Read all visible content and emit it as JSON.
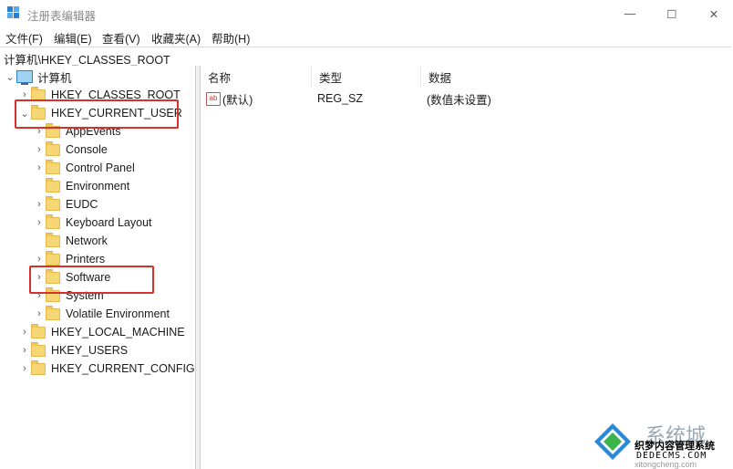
{
  "window": {
    "title": "注册表编辑器",
    "minimize": "—",
    "maximize": "☐",
    "close": "✕"
  },
  "menu": [
    "文件(F)",
    "编辑(E)",
    "查看(V)",
    "收藏夹(A)",
    "帮助(H)"
  ],
  "address": "计算机\\HKEY_CLASSES_ROOT",
  "tree": {
    "root": "计算机",
    "hives": {
      "classes_root": "HKEY_CLASSES_ROOT",
      "current_user": "HKEY_CURRENT_USER",
      "local_machine": "HKEY_LOCAL_MACHINE",
      "users": "HKEY_USERS",
      "current_config": "HKEY_CURRENT_CONFIG"
    },
    "current_user_children": [
      "AppEvents",
      "Console",
      "Control Panel",
      "Environment",
      "EUDC",
      "Keyboard Layout",
      "Network",
      "Printers",
      "Software",
      "System",
      "Volatile Environment"
    ]
  },
  "list": {
    "headers": {
      "name": "名称",
      "type": "类型",
      "data": "数据"
    },
    "rows": [
      {
        "icon": "ab",
        "name": "(默认)",
        "type": "REG_SZ",
        "data": "(数值未设置)"
      }
    ]
  },
  "watermark": {
    "line1": "系统城",
    "line2": "织梦内容管理系统",
    "line3": "DEDECMS.COM",
    "line4": "xitongcheng.com"
  },
  "colors": {
    "highlight": "#d8302a",
    "folder": "#f7d675"
  }
}
